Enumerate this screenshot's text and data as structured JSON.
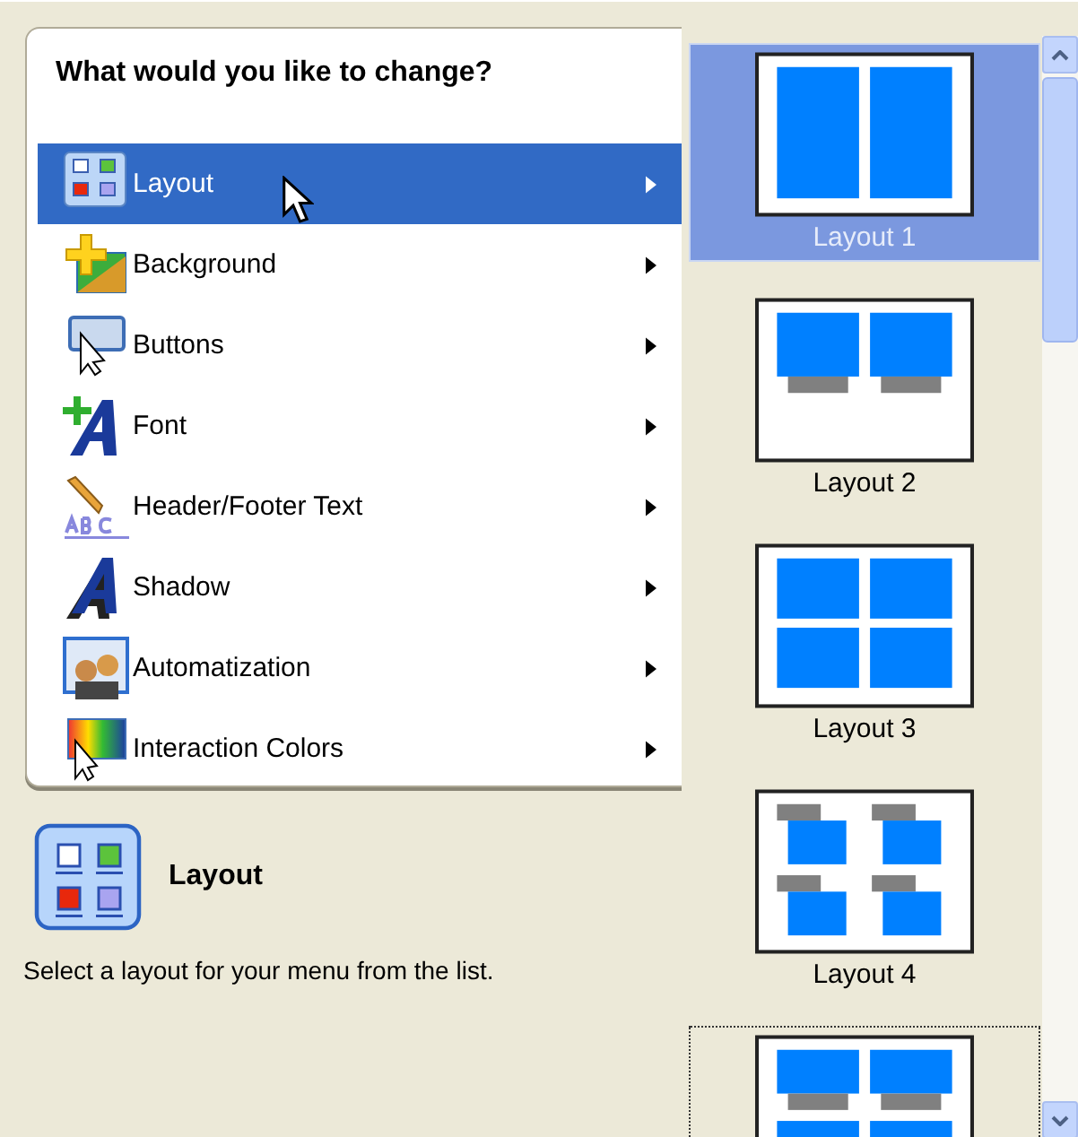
{
  "menu": {
    "heading": "What would you like to change?",
    "items": [
      {
        "label": "Layout",
        "selected": true
      },
      {
        "label": "Background",
        "selected": false
      },
      {
        "label": "Buttons",
        "selected": false
      },
      {
        "label": "Font",
        "selected": false
      },
      {
        "label": "Header/Footer Text",
        "selected": false
      },
      {
        "label": "Shadow",
        "selected": false
      },
      {
        "label": "Automatization",
        "selected": false
      },
      {
        "label": "Interaction Colors",
        "selected": false
      }
    ]
  },
  "detail": {
    "title": "Layout",
    "description": "Select a layout for your menu from the list."
  },
  "layouts": [
    {
      "kind": "two-columns",
      "label": "Layout 1",
      "selected": true,
      "focused": false
    },
    {
      "kind": "two-captioned",
      "label": "Layout 2",
      "selected": false,
      "focused": false
    },
    {
      "kind": "four",
      "label": "Layout 3",
      "selected": false,
      "focused": false
    },
    {
      "kind": "four-tabbed",
      "label": "Layout 4",
      "selected": false,
      "focused": false
    },
    {
      "kind": "four-captioned",
      "selected": false,
      "focused": true
    }
  ]
}
